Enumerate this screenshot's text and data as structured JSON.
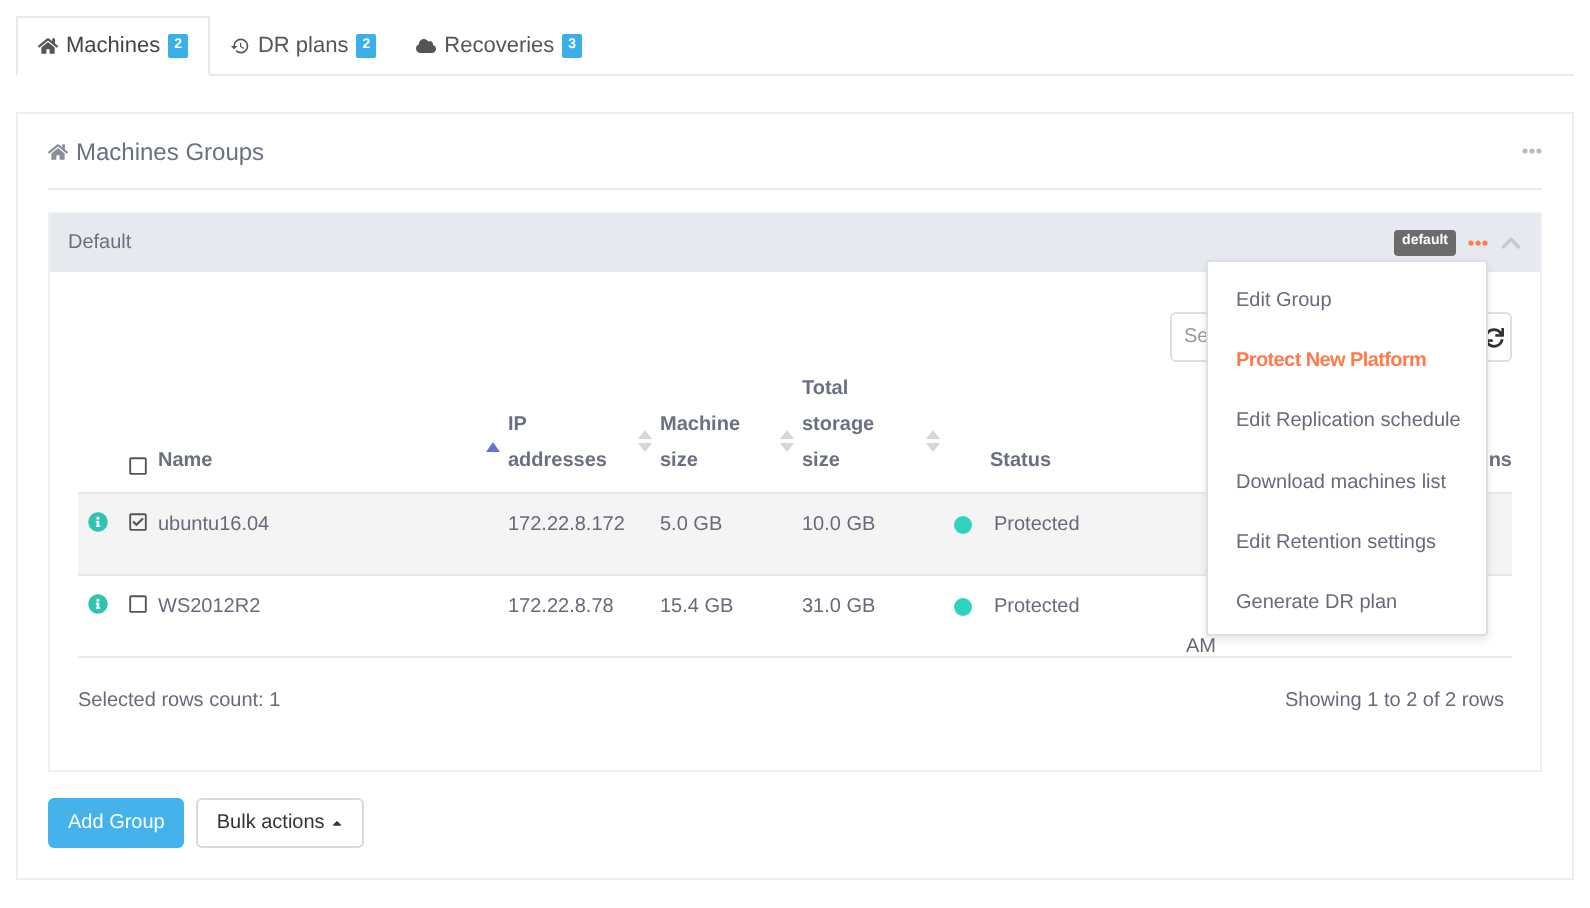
{
  "tabs": [
    {
      "label": "Machines",
      "count": "2",
      "selected": true
    },
    {
      "label": "DR plans",
      "count": "2",
      "selected": false
    },
    {
      "label": "Recoveries",
      "count": "3",
      "selected": false
    }
  ],
  "panel": {
    "title": "Machines Groups"
  },
  "group": {
    "name": "Default",
    "badge": "default",
    "expanded": true,
    "search": {
      "placeholder": "Se"
    },
    "table": {
      "columns": [
        {
          "label": "Name",
          "kind": "sortable",
          "sorted": true
        },
        {
          "label": "IP addresses",
          "kind": "sortable",
          "sorted": false
        },
        {
          "label": "Machine size",
          "kind": "sortable",
          "sorted": false
        },
        {
          "label": "Total storage size",
          "kind": "sortable",
          "sorted": false
        },
        {
          "label": "Status",
          "kind": "plain"
        },
        {
          "label": "ns",
          "kind": "plain"
        }
      ],
      "all_checked": false,
      "rows": [
        {
          "name": "ubuntu16.04",
          "ip": "172.22.8.172",
          "machine_size": "5.0 GB",
          "storage": "10.0 GB",
          "status": "Protected",
          "color": "#2fd4c0",
          "checked": true,
          "selected": true
        },
        {
          "name": "WS2012R2",
          "ip": "172.22.8.78",
          "machine_size": "15.4 GB",
          "storage": "31.0 GB",
          "status": "Protected",
          "color": "#2fd4c0",
          "column_7": "AM",
          "checked": false,
          "selected": false
        }
      ]
    },
    "footer_left": "Selected rows count: 1",
    "footer_right": "Showing 1 to 2 of 2 rows",
    "menu": [
      {
        "label": "Edit Group",
        "highlighted": false
      },
      {
        "label": "Protect New Platform",
        "highlighted": true
      },
      {
        "label": "Edit Replication schedule",
        "highlighted": false
      },
      {
        "label": "Download machines list",
        "highlighted": false
      },
      {
        "label": "Edit Retention settings",
        "highlighted": false
      },
      {
        "label": "Generate DR plan",
        "highlighted": false
      }
    ]
  },
  "buttons": [
    {
      "label": "Add Group",
      "kind": "primary"
    },
    {
      "label": "Bulk actions",
      "kind": "dropdown"
    }
  ]
}
